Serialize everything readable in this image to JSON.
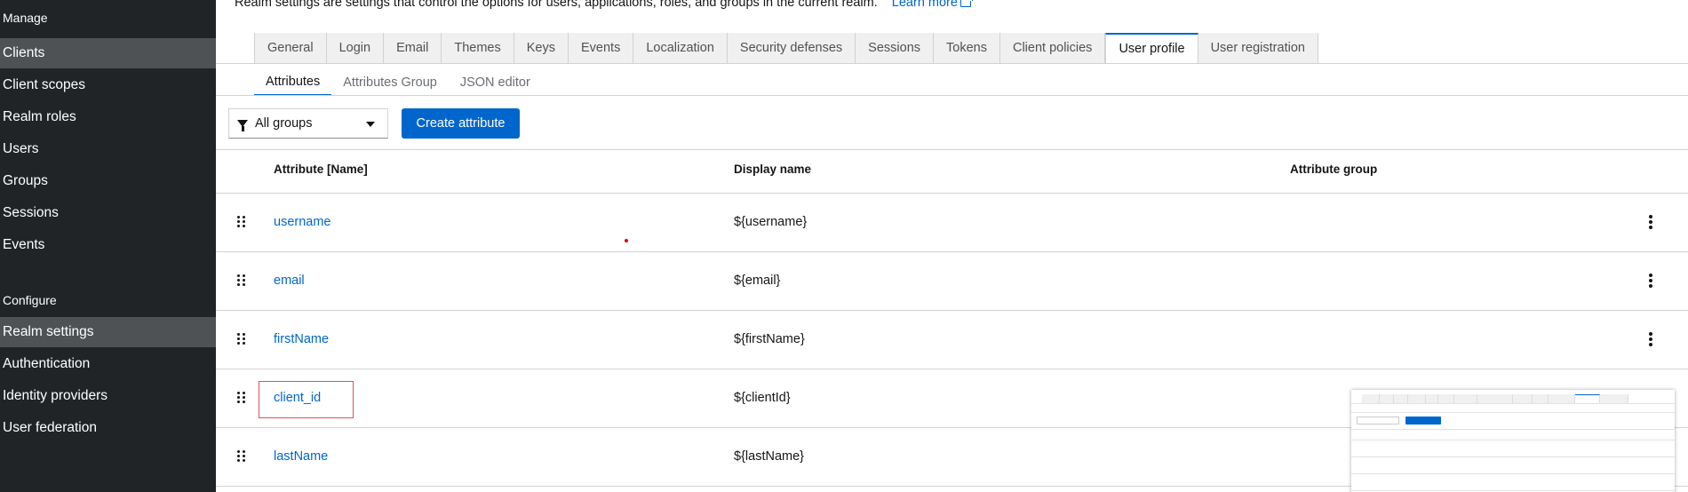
{
  "sidebar": {
    "sections": {
      "manage": "Manage",
      "configure": "Configure"
    },
    "manage_items": [
      {
        "label": "Clients",
        "active": true
      },
      {
        "label": "Client scopes",
        "active": false
      },
      {
        "label": "Realm roles",
        "active": false
      },
      {
        "label": "Users",
        "active": false
      },
      {
        "label": "Groups",
        "active": false
      },
      {
        "label": "Sessions",
        "active": false
      },
      {
        "label": "Events",
        "active": false
      }
    ],
    "configure_items": [
      {
        "label": "Realm settings",
        "active": true
      },
      {
        "label": "Authentication",
        "active": false
      },
      {
        "label": "Identity providers",
        "active": false
      },
      {
        "label": "User federation",
        "active": false
      }
    ]
  },
  "header": {
    "description": "Realm settings are settings that control the options for users, applications, roles, and groups in the current realm.",
    "learn_more": "Learn more"
  },
  "tabs": [
    {
      "label": "General"
    },
    {
      "label": "Login"
    },
    {
      "label": "Email"
    },
    {
      "label": "Themes"
    },
    {
      "label": "Keys"
    },
    {
      "label": "Events"
    },
    {
      "label": "Localization"
    },
    {
      "label": "Security defenses"
    },
    {
      "label": "Sessions"
    },
    {
      "label": "Tokens"
    },
    {
      "label": "Client policies"
    },
    {
      "label": "User profile"
    },
    {
      "label": "User registration"
    }
  ],
  "active_tab": "User profile",
  "subtabs": [
    {
      "label": "Attributes"
    },
    {
      "label": "Attributes Group"
    },
    {
      "label": "JSON editor"
    }
  ],
  "active_subtab": "Attributes",
  "toolbar": {
    "group_filter": "All groups",
    "create_label": "Create attribute"
  },
  "table": {
    "headers": {
      "attribute": "Attribute [Name]",
      "display": "Display name",
      "group": "Attribute group"
    },
    "rows": [
      {
        "name": "username",
        "display": "${username}",
        "group": "",
        "has_menu": true
      },
      {
        "name": "email",
        "display": "${email}",
        "group": "",
        "has_menu": true
      },
      {
        "name": "firstName",
        "display": "${firstName}",
        "group": "",
        "has_menu": true
      },
      {
        "name": "client_id",
        "display": "${clientId}",
        "group": "",
        "has_menu": false,
        "highlighted": true
      },
      {
        "name": "lastName",
        "display": "${lastName}",
        "group": "",
        "has_menu": false
      }
    ]
  },
  "colors": {
    "sidebar_bg": "#212427",
    "sidebar_active": "#4f5255",
    "accent": "#0066cc",
    "highlight_border": "#e0505a"
  },
  "icons": {
    "learn_more": "external-link-icon",
    "filter": "filter-icon",
    "dropdown": "caret-down-icon",
    "drag": "drag-handle-icon",
    "row_menu": "kebab-menu-icon"
  }
}
